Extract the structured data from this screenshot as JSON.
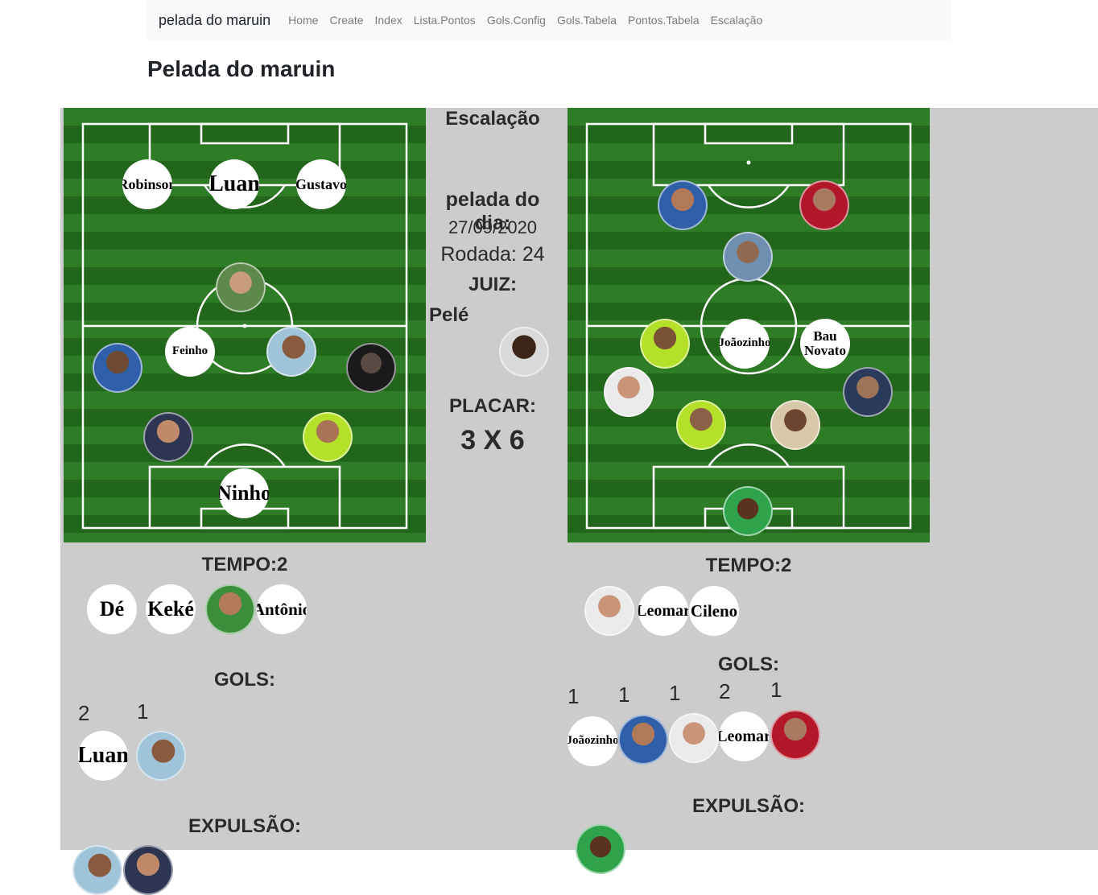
{
  "navbar": {
    "brand": "pelada do maruin",
    "links": [
      "Home",
      "Create",
      "Index",
      "Lista.Pontos",
      "Gols.Config",
      "Gols.Tabela",
      "Pontos.Tabela",
      "Escalação"
    ]
  },
  "page_title": "Pelada do maruin",
  "center": {
    "heading": "Escalação",
    "date_label": "pelada do dia:",
    "date": "27/09/2020",
    "round": "Rodada: 24",
    "referee_label": "JUIZ:",
    "referee_name": "Pelé",
    "score_label": "PLACAR:",
    "score": "3 X 6"
  },
  "team_a": {
    "field_names": {
      "robinson": "Robinson",
      "luan": "Luan",
      "gustavo": "Gustavo",
      "feinho": "Feinho",
      "ninho": "Ninho"
    },
    "tempo_label": "TEMPO:2",
    "bench": {
      "de": "Dé",
      "keke": "Keké",
      "antonio": "Antônio"
    },
    "gols_label": "GOLS:",
    "goals": {
      "count_1": "2",
      "count_2": "1",
      "scorer_1": "Luan"
    },
    "expulsao_label": "EXPULSÃO:"
  },
  "team_b": {
    "field_names": {
      "joaozinho": "Joãozinho",
      "bau_novato": "Bau Novato"
    },
    "tempo_label": "TEMPO:2",
    "bench": {
      "leomar": "Leomar",
      "cileno": "Cileno"
    },
    "gols_label": "GOLS:",
    "goals": {
      "count_1": "1",
      "count_2": "1",
      "count_3": "1",
      "count_4": "2",
      "count_5": "1",
      "scorer_1": "Joãozinho",
      "scorer_4": "Leomar"
    },
    "expulsao_label": "EXPULSÃO:"
  },
  "colors": {
    "navbar_bg": "#f8f9fa",
    "board_bg": "#cccccc",
    "pitch_green": "#2e7d26"
  }
}
